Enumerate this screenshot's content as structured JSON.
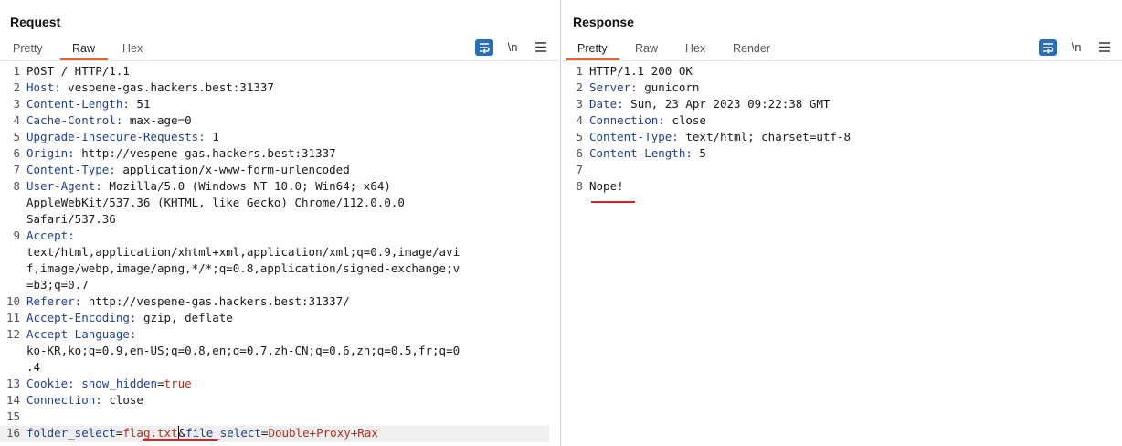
{
  "request": {
    "title": "Request",
    "tabs": [
      "Pretty",
      "Raw",
      "Hex"
    ],
    "active_tab": "Raw",
    "newline_toggle": "\\n",
    "lines": [
      {
        "n": "1",
        "text": "POST / HTTP/1.1"
      },
      {
        "n": "2",
        "name": "Host:",
        "value": " vespene-gas.hackers.best:31337"
      },
      {
        "n": "3",
        "name": "Content-Length:",
        "value": " 51"
      },
      {
        "n": "4",
        "name": "Cache-Control:",
        "value": " max-age=0"
      },
      {
        "n": "5",
        "name": "Upgrade-Insecure-Requests:",
        "value": " 1"
      },
      {
        "n": "6",
        "name": "Origin:",
        "value": " http://vespene-gas.hackers.best:31337"
      },
      {
        "n": "7",
        "name": "Content-Type:",
        "value": " application/x-www-form-urlencoded"
      },
      {
        "n": "8",
        "name": "User-Agent:",
        "value": " Mozilla/5.0 (Windows NT 10.0; Win64; x64)"
      },
      {
        "n": "",
        "text": "AppleWebKit/537.36 (KHTML, like Gecko) Chrome/112.0.0.0"
      },
      {
        "n": "",
        "text": "Safari/537.36"
      },
      {
        "n": "9",
        "name": "Accept:",
        "value": ""
      },
      {
        "n": "",
        "text": "text/html,application/xhtml+xml,application/xml;q=0.9,image/avi"
      },
      {
        "n": "",
        "text": "f,image/webp,image/apng,*/*;q=0.8,application/signed-exchange;v"
      },
      {
        "n": "",
        "text": "=b3;q=0.7"
      },
      {
        "n": "10",
        "name": "Referer:",
        "value": " http://vespene-gas.hackers.best:31337/"
      },
      {
        "n": "11",
        "name": "Accept-Encoding:",
        "value": " gzip, deflate"
      },
      {
        "n": "12",
        "name": "Accept-Language:",
        "value": ""
      },
      {
        "n": "",
        "text": "ko-KR,ko;q=0.9,en-US;q=0.8,en;q=0.7,zh-CN;q=0.6,zh;q=0.5,fr;q=0"
      },
      {
        "n": "",
        "text": ".4"
      },
      {
        "n": "13",
        "name": "Cookie:",
        "cookie_name": " show_hidden",
        "cookie_eq": "=",
        "cookie_value": "true"
      },
      {
        "n": "14",
        "name": "Connection:",
        "value": " close"
      },
      {
        "n": "15",
        "text": ""
      },
      {
        "n": "16",
        "body": [
          "folder_select",
          "=",
          "flag.txt",
          "&",
          "file_select",
          "=",
          "Double+Proxy+Rax"
        ]
      }
    ]
  },
  "response": {
    "title": "Response",
    "tabs": [
      "Pretty",
      "Raw",
      "Hex",
      "Render"
    ],
    "active_tab": "Pretty",
    "newline_toggle": "\\n",
    "lines": [
      {
        "n": "1",
        "text": "HTTP/1.1 200 OK"
      },
      {
        "n": "2",
        "name": "Server:",
        "value": " gunicorn"
      },
      {
        "n": "3",
        "name": "Date:",
        "value": " Sun, 23 Apr 2023 09:22:38 GMT"
      },
      {
        "n": "4",
        "name": "Connection:",
        "value": " close"
      },
      {
        "n": "5",
        "name": "Content-Type:",
        "value": " text/html; charset=utf-8"
      },
      {
        "n": "6",
        "name": "Content-Length:",
        "value": " 5"
      },
      {
        "n": "7",
        "text": ""
      },
      {
        "n": "8",
        "text": "Nope!"
      }
    ]
  },
  "layout_buttons": [
    "split-horizontal-icon",
    "split-vertical-icon",
    "single-pane-icon"
  ],
  "colors": {
    "accent": "#e8612c",
    "header_name": "#1f3f8f",
    "param_value": "#b03020",
    "annotation": "#d42222",
    "toolbar_blue": "#2a6fb5"
  }
}
